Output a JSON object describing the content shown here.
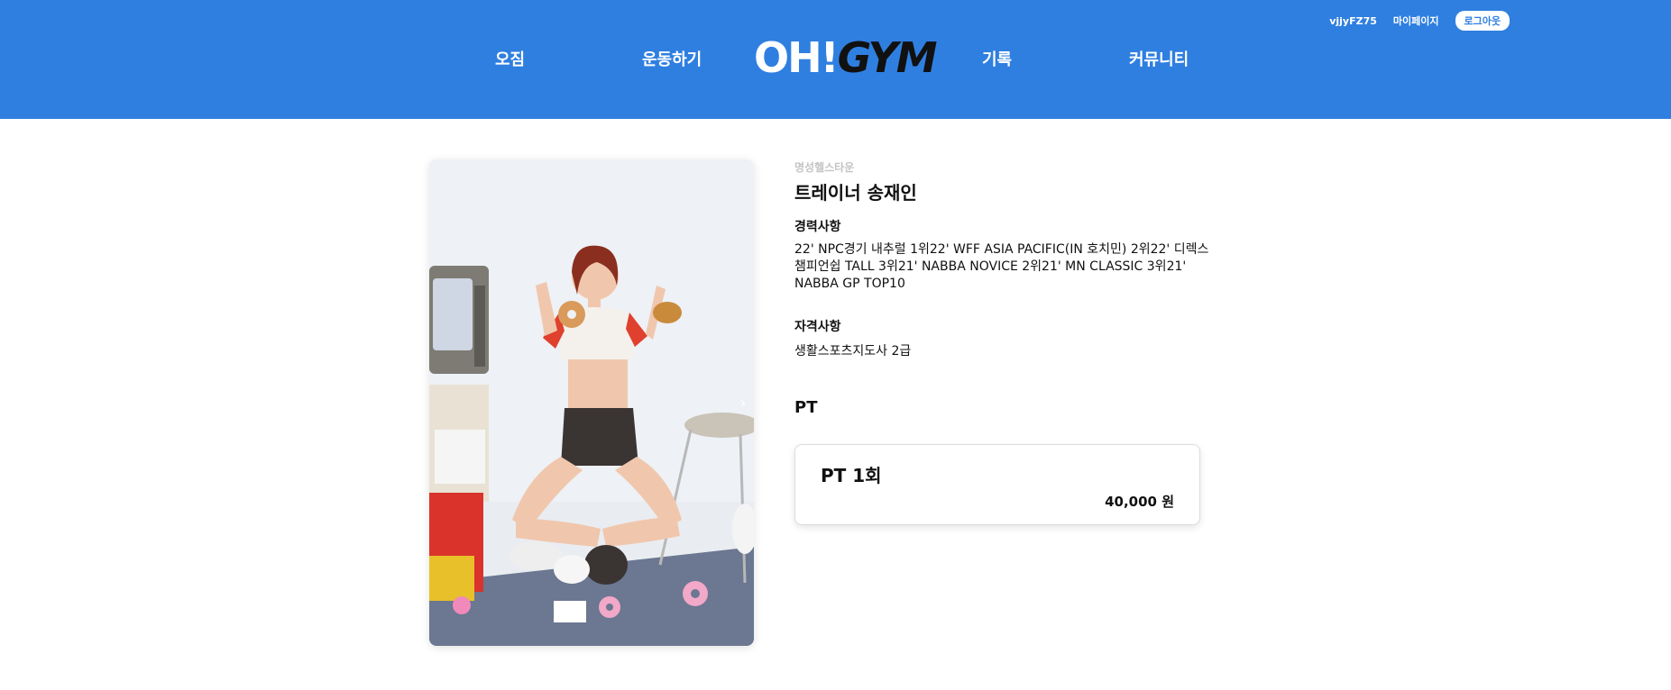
{
  "header": {
    "username": "vjjyFZ75",
    "mypage_label": "마이페이지",
    "logout_label": "로그아웃",
    "nav": [
      "오짐",
      "운동하기",
      "기록",
      "커뮤니티"
    ],
    "logo_part1": "OH!",
    "logo_part2": "GYM",
    "bg_color": "#2f7fe0"
  },
  "trainer": {
    "gym_name": "명성헬스타운",
    "name": "트레이너 송재인",
    "career_title": "경력사항",
    "career_text": "22' NPC경기 내추럴 1위22' WFF ASIA PACIFIC(IN 호치민) 2위22' 디렉스 챔피언쉽 TALL 3위21' NABBA NOVICE 2위21' MN CLASSIC 3위21' NABBA GP TOP10",
    "qual_title": "자격사항",
    "qual_text": "생활스포츠지도사 2급"
  },
  "pt": {
    "heading": "PT",
    "items": [
      {
        "name": "PT 1회",
        "price": "40,000 원"
      }
    ]
  },
  "icons": {
    "next": "chevron-right-icon"
  }
}
